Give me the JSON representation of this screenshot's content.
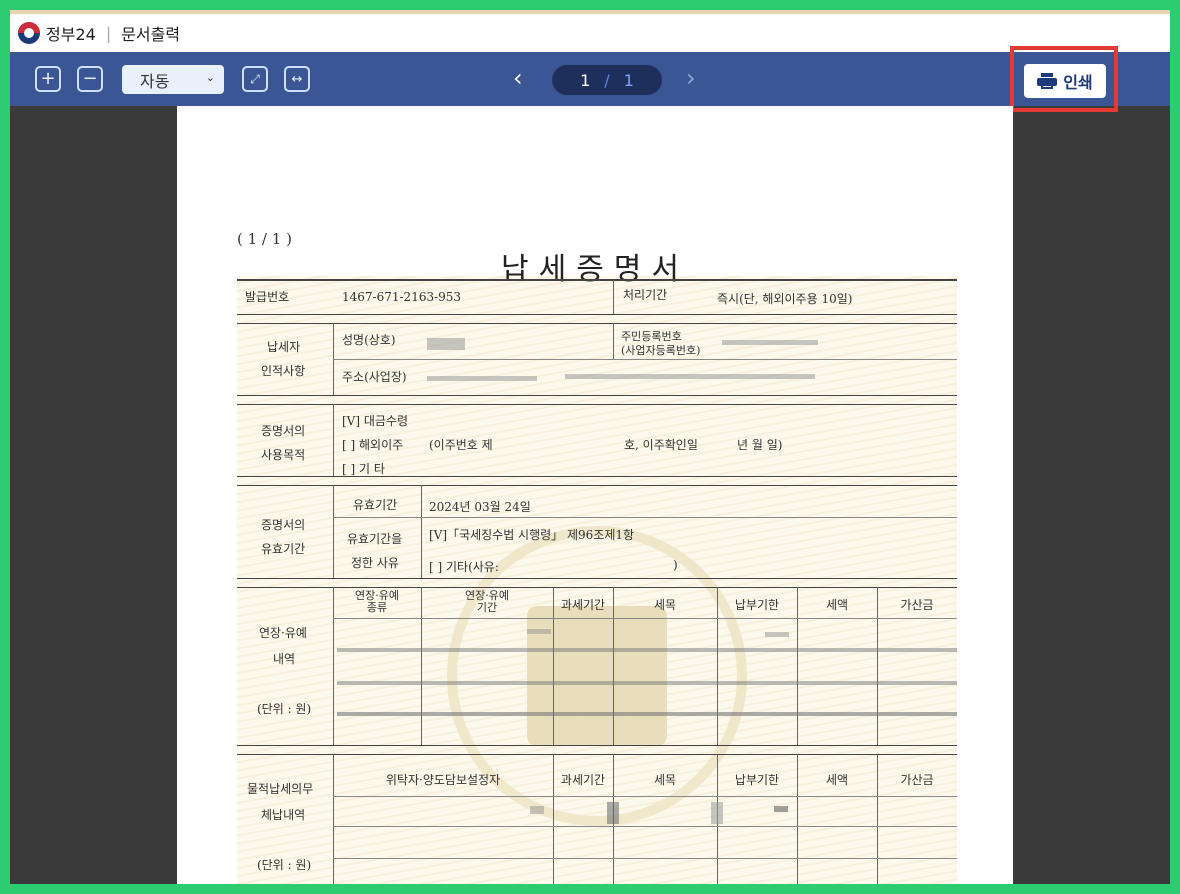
{
  "app": {
    "title": "정부24",
    "subtitle": "문서출력"
  },
  "toolbar": {
    "zoom_in": "+",
    "zoom_out": "−",
    "zoom_value": "자동",
    "page_current": "1",
    "page_sep": "/",
    "page_total": "1",
    "print_label": "인쇄"
  },
  "document": {
    "page_indicator": "( 1 / 1 )",
    "title": "납세증명서",
    "issue_no_label": "발급번호",
    "issue_no": "1467-671-2163-953",
    "processing_label": "처리기간",
    "processing_value": "즉시(단, 해외이주용 10일)",
    "taxpayer_label1": "납세자",
    "taxpayer_label2": "인적사항",
    "name_label": "성명(상호)",
    "resident_label1": "주민등록번호",
    "resident_label2": "(사업자등록번호)",
    "address_label": "주소(사업장)",
    "purpose_label1": "증명서의",
    "purpose_label2": "사용목적",
    "purpose_opt1": "[V] 대금수령",
    "purpose_opt2": "[ ] 해외이주",
    "purpose_opt2_detail": "(이주번호 제",
    "purpose_opt2_detail2": "호, 이주확인일",
    "purpose_date": "년     월     일)",
    "purpose_opt3": "[ ] 기       타",
    "validity_label1": "증명서의",
    "validity_label2": "유효기간",
    "validity_period_label": "유효기간",
    "validity_period": "2024년 03월 24일",
    "validity_reason_label1": "유효기간을",
    "validity_reason_label2": "정한 사유",
    "validity_reason1": "[V]「국세징수법 시행령」 제96조제1항",
    "validity_reason2": "[  ]  기타(사유:",
    "validity_reason2_end": ")",
    "deferral_label1": "연장·유예",
    "deferral_label2": "내역",
    "unit_label": "(단위 : 원)",
    "deferral_headers": [
      "연장·유예\n종류",
      "연장·유예\n기간",
      "과세기간",
      "세목",
      "납부기한",
      "세액",
      "가산금"
    ],
    "physical_label1": "물적납세의무",
    "physical_label2": "체납내역",
    "physical_headers": [
      "위탁자·양도담보설정자",
      "과세기간",
      "세목",
      "납부기한",
      "세액",
      "가산금"
    ]
  }
}
